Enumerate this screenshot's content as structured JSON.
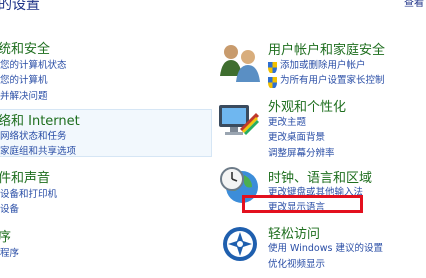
{
  "header": {
    "title": "的设置",
    "right": "查看"
  },
  "left": {
    "security": {
      "title": "统和安全",
      "links": [
        "您的计算机状态",
        "您的计算机",
        "并解决问题"
      ]
    },
    "network": {
      "title": "络和 Internet",
      "links": [
        "网络状态和任务",
        "家庭组和共享选项"
      ]
    },
    "hardware": {
      "title": "件和声音",
      "links": [
        "设备和打印机",
        "设备"
      ]
    },
    "programs": {
      "title": "序",
      "links": [
        "程序"
      ]
    }
  },
  "right": {
    "users": {
      "title": "用户帐户和家庭安全",
      "links": [
        "添加或删除用户帐户",
        "为所有用户设置家长控制"
      ]
    },
    "appearance": {
      "title": "外观和个性化",
      "links": [
        "更改主题",
        "更改桌面背景",
        "调整屏幕分辨率"
      ]
    },
    "clock": {
      "title": "时钟、语言和区域",
      "links": [
        "更改键盘或其他输入法",
        "更改显示语言"
      ]
    },
    "ease": {
      "title": "轻松访问",
      "links": [
        "使用 Windows 建议的设置",
        "优化视频显示"
      ]
    }
  },
  "colors": {
    "highlight": "#e3101e",
    "heading": "#1e6e1e",
    "link": "#2a4ea6"
  }
}
